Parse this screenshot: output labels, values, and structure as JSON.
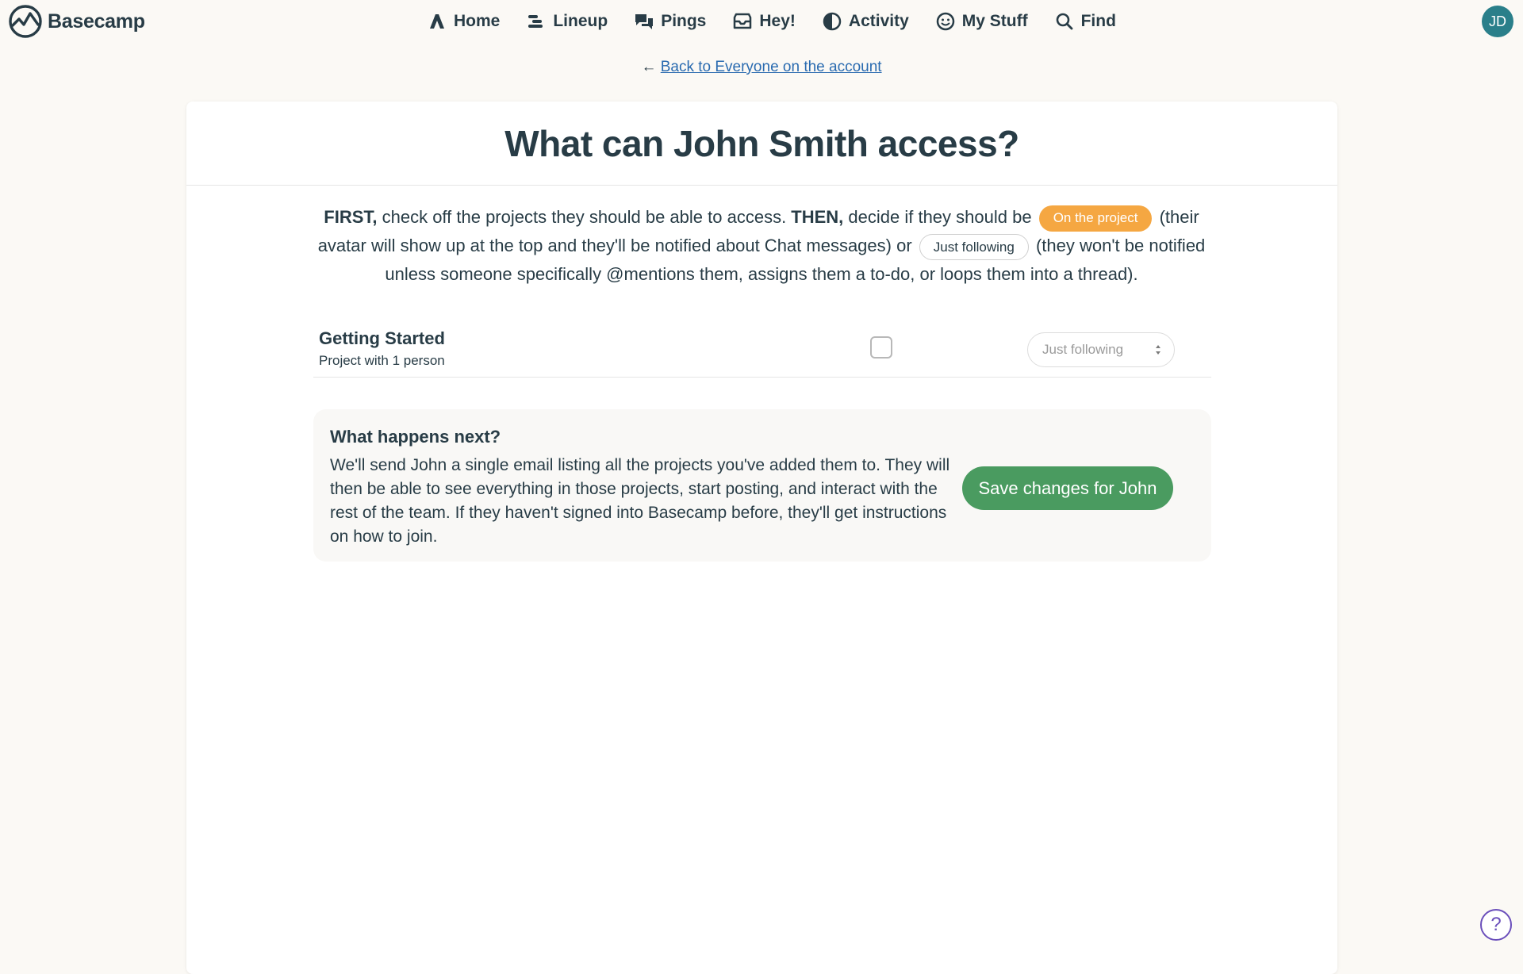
{
  "app": {
    "name": "Basecamp"
  },
  "nav": {
    "items": [
      {
        "label": "Home",
        "icon": "home-icon"
      },
      {
        "label": "Lineup",
        "icon": "lineup-icon"
      },
      {
        "label": "Pings",
        "icon": "pings-icon"
      },
      {
        "label": "Hey!",
        "icon": "hey-inbox-icon"
      },
      {
        "label": "Activity",
        "icon": "activity-icon"
      },
      {
        "label": "My Stuff",
        "icon": "my-stuff-icon"
      },
      {
        "label": "Find",
        "icon": "search-icon"
      }
    ]
  },
  "user": {
    "initials": "JD",
    "avatar_color": "#2a7f8a"
  },
  "back": {
    "arrow": "←",
    "label": "Back to Everyone on the account"
  },
  "page": {
    "title": "What can John Smith access?"
  },
  "intro": {
    "first": "FIRST,",
    "part1": " check off the projects they should be able to access. ",
    "then": "THEN,",
    "part2": " decide if they should be ",
    "on_project_pill": "On the project",
    "part3": " (their avatar will show up at the top and they'll be notified about Chat messages) or ",
    "just_following_pill": "Just following",
    "part4": " (they won't be notified unless someone specifically @mentions them, assigns them a to-do, or loops them into a thread)."
  },
  "projects": [
    {
      "name": "Getting Started",
      "subtitle": "Project with 1 person",
      "checked": false,
      "access": "Just following"
    }
  ],
  "next": {
    "title": "What happens next?",
    "body": "We'll send John a single email listing all the projects you've added them to. They will then be able to see everything in those projects, start posting, and interact with the rest of the team. If they haven't signed into Basecamp before, they'll get instructions on how to join.",
    "save_label": "Save changes for John"
  },
  "help": {
    "label": "?"
  },
  "colors": {
    "background": "#fbf9f5",
    "text": "#283c46",
    "link": "#2a6bb0",
    "on_project": "#f5a742",
    "save_button": "#4a9b60",
    "help": "#6b4fbb"
  }
}
